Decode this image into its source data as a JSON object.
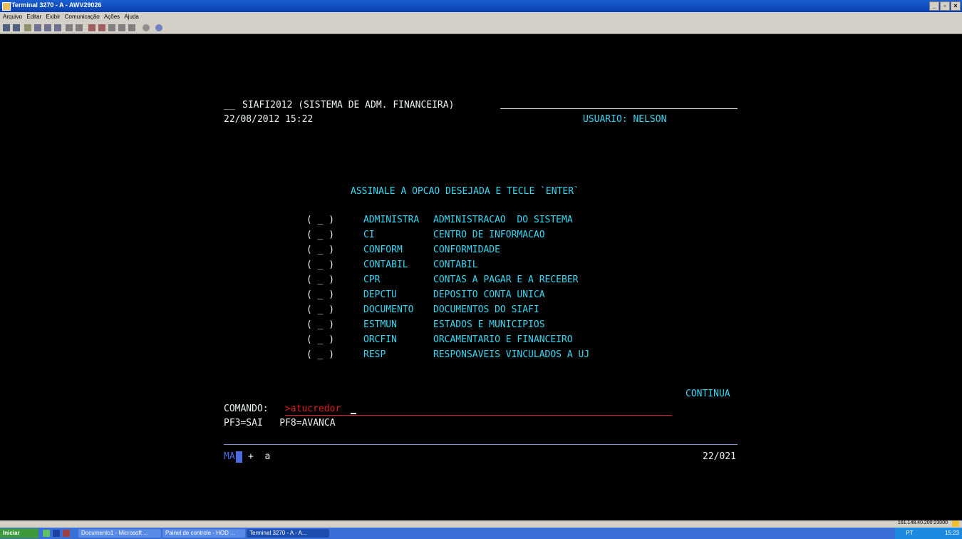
{
  "window": {
    "title": "Terminal 3270 - A - AWV29026"
  },
  "menu": [
    "Arquivo",
    "Editar",
    "Exibir",
    "Comunicação",
    "Ações",
    "Ajuda"
  ],
  "screen": {
    "header_prefix": "__",
    "system_title": "SIAFI2012 (SISTEMA DE ADM. FINANCEIRA)",
    "datetime": "22/08/2012 15:22",
    "user": "USUARIO: NELSON",
    "instruction": "ASSINALE A OPCAO DESEJADA E TECLE `ENTER`",
    "options": [
      {
        "sel": "( _ )",
        "code": "ADMINISTRA",
        "desc": "ADMINISTRACAO  DO SISTEMA"
      },
      {
        "sel": "( _ )",
        "code": "CI",
        "desc": "CENTRO DE INFORMACAO"
      },
      {
        "sel": "( _ )",
        "code": "CONFORM",
        "desc": "CONFORMIDADE"
      },
      {
        "sel": "( _ )",
        "code": "CONTABIL",
        "desc": "CONTABIL"
      },
      {
        "sel": "( _ )",
        "code": "CPR",
        "desc": "CONTAS A PAGAR E A RECEBER"
      },
      {
        "sel": "( _ )",
        "code": "DEPCTU",
        "desc": "DEPOSITO CONTA UNICA"
      },
      {
        "sel": "( _ )",
        "code": "DOCUMENTO",
        "desc": "DOCUMENTOS DO SIAFI"
      },
      {
        "sel": "( _ )",
        "code": "ESTMUN",
        "desc": "ESTADOS E MUNICIPIOS"
      },
      {
        "sel": "( _ )",
        "code": "ORCFIN",
        "desc": "ORCAMENTARIO E FINANCEIRO"
      },
      {
        "sel": "( _ )",
        "code": "RESP",
        "desc": "RESPONSAVEIS VINCULADOS A UJ"
      }
    ],
    "continua": "CONTINUA",
    "command_label": "COMANDO:",
    "command_value": ">atucredor",
    "pf_keys": "PF3=SAI   PF8=AVANCA",
    "oia_left": "MA",
    "oia_mid": "+  a",
    "cursor_pos": "22/021"
  },
  "statusbar": {
    "host": "161.148.40.200:23000"
  },
  "taskbar": {
    "start": "Iniciar",
    "tasks": [
      "Documento1 - Microsoft ...",
      "Painel de controle - HOD ...",
      "Terminal 3270 - A - A..."
    ],
    "tray": "PT",
    "clock": "15:23"
  },
  "colors": {
    "field_text": "#e9f2f0",
    "protected_text": "#39d6f0",
    "command_text": "#e02020",
    "background": "#000000"
  }
}
